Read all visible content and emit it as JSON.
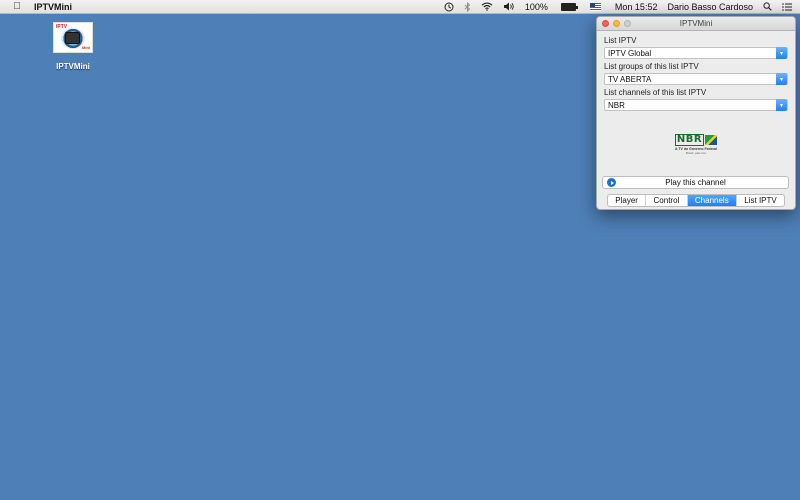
{
  "menubar": {
    "app_name": "IPTVMini",
    "battery_percent": "100%",
    "clock": "Mon 15:52",
    "user": "Dario Basso Cardoso"
  },
  "desktop": {
    "icon_label": "IPTVMini"
  },
  "window": {
    "title": "IPTVMini",
    "list_iptv_label": "List IPTV",
    "list_iptv_value": "IPTV Global",
    "groups_label": "List groups of this list IPTV",
    "groups_value": "TV ABERTA",
    "channels_label": "List channels of this list IPTV",
    "channels_value": "NBR",
    "play_button": "Play this channel",
    "logo": {
      "name": "NBR",
      "subtitle": "A TV do Governo Federal",
      "tagline": "Brasil, pais rico"
    },
    "tabs": [
      {
        "label": "Player",
        "active": false
      },
      {
        "label": "Control",
        "active": false
      },
      {
        "label": "Channels",
        "active": true
      },
      {
        "label": "List IPTV",
        "active": false
      }
    ]
  },
  "colors": {
    "desktop": "#4e7fb7",
    "accent": "#1a82f7"
  }
}
